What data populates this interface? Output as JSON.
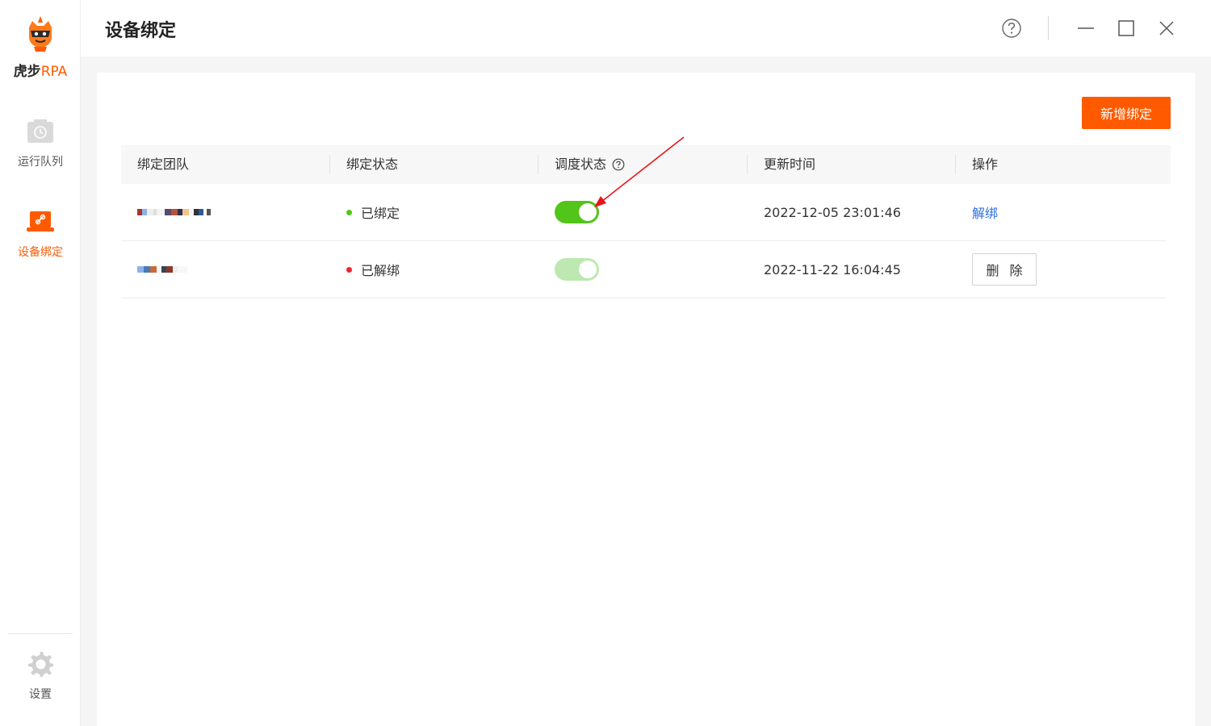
{
  "app": {
    "logo_main": "虎步",
    "logo_accent": "RPA",
    "accent_color": "#ff5a00"
  },
  "sidebar": {
    "items": [
      {
        "label": "运行队列",
        "icon": "clock-box-icon",
        "active": false
      },
      {
        "label": "设备绑定",
        "icon": "laptop-link-icon",
        "active": true
      }
    ],
    "settings_label": "设置"
  },
  "header": {
    "title": "设备绑定"
  },
  "toolbar": {
    "add_label": "新增绑定"
  },
  "table": {
    "columns": [
      "绑定团队",
      "绑定状态",
      "调度状态",
      "更新时间",
      "操作"
    ],
    "rows": [
      {
        "team": "",
        "status": "已绑定",
        "status_color": "#52c41a",
        "schedule_on": true,
        "updated": "2022-12-05 23:01:46",
        "action": "解绑"
      },
      {
        "team": "",
        "status": "已解绑",
        "status_color": "#f5222d",
        "schedule_on": true,
        "schedule_disabled": true,
        "updated": "2022-11-22 16:04:45",
        "action": "删 除"
      }
    ]
  }
}
